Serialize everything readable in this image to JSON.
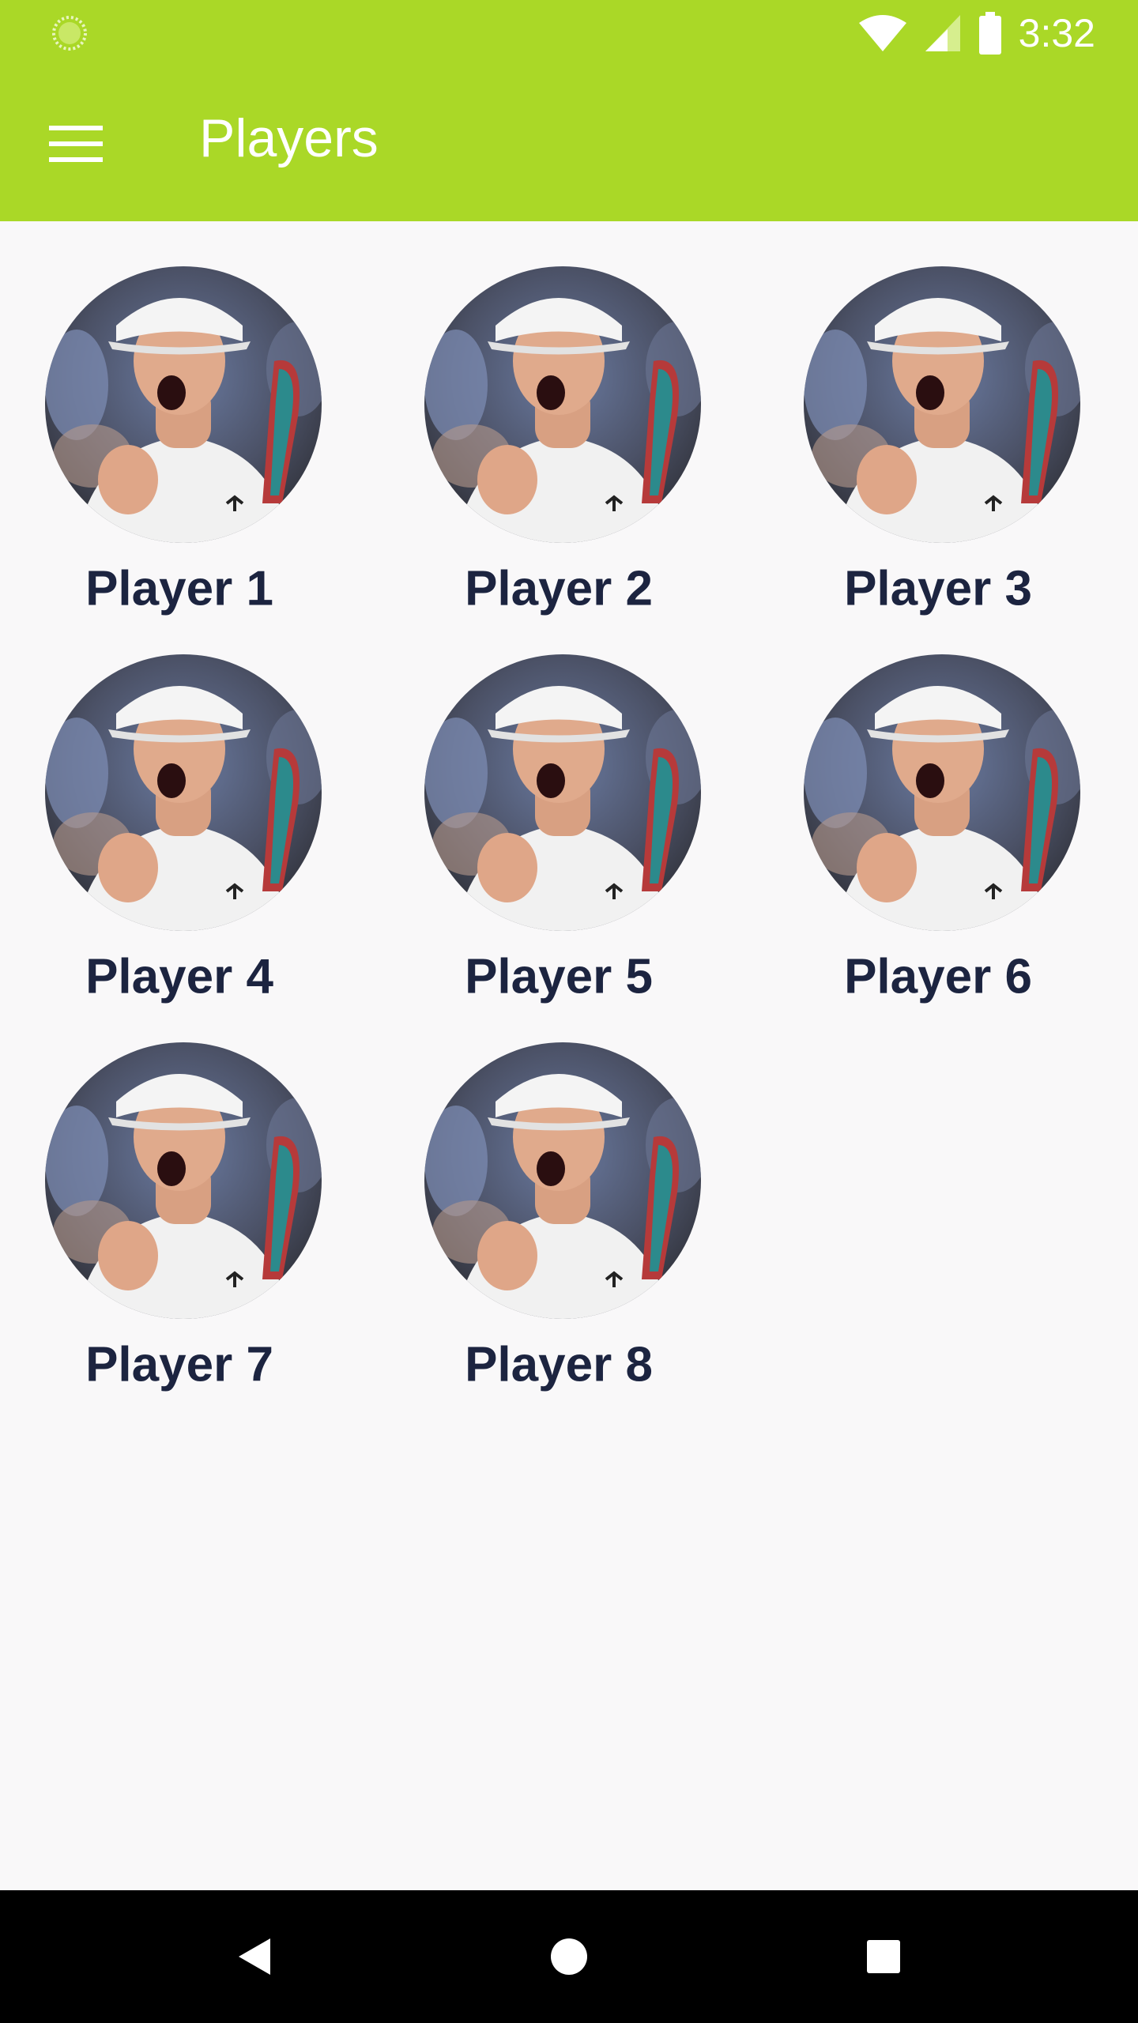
{
  "status_bar": {
    "time": "3:32",
    "icons": [
      "loading-icon",
      "wifi-icon",
      "signal-icon",
      "battery-icon"
    ],
    "background": "#aad827"
  },
  "app_bar": {
    "title": "Players",
    "menu_icon": "hamburger-menu-icon",
    "background": "#aad827",
    "text_color": "#ffffff"
  },
  "players": [
    {
      "name": "Player 1"
    },
    {
      "name": "Player 2"
    },
    {
      "name": "Player 3"
    },
    {
      "name": "Player 4"
    },
    {
      "name": "Player 5"
    },
    {
      "name": "Player 6"
    },
    {
      "name": "Player 7"
    },
    {
      "name": "Player 8"
    }
  ],
  "nav_bar": {
    "buttons": [
      "back-icon",
      "home-icon",
      "recents-icon"
    ]
  },
  "colors": {
    "page_background": "#f9f8f9",
    "player_name": "#1c2440"
  }
}
